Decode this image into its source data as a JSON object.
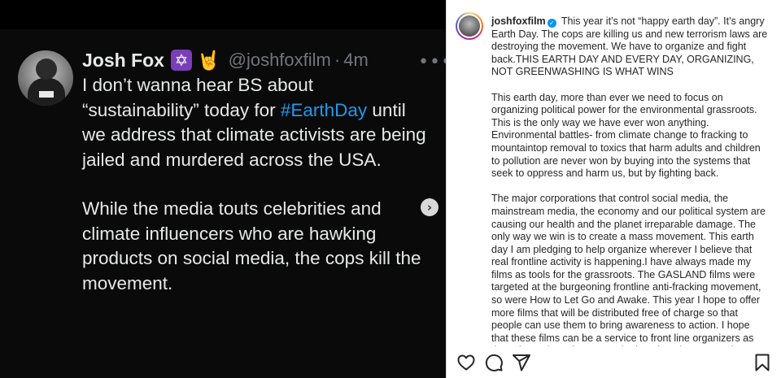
{
  "media": {
    "tweet": {
      "name": "Josh Fox",
      "emoji_1": "✡",
      "emoji_2": "🤘",
      "handle": "@joshfoxfilm",
      "separator": "·",
      "time": "4m",
      "more": "•••",
      "paragraph_1_before": "I don’t wanna hear BS about “sustainability” today for ",
      "hashtag": "#EarthDay",
      "paragraph_1_after": " until we address that climate activists are being jailed and murdered across the USA.",
      "paragraph_2": "While the media touts celebrities and climate influencers who are hawking products on social media, the cops kill the movement."
    },
    "next_button": "›"
  },
  "post": {
    "username": "joshfoxfilm",
    "verified_glyph": "✓",
    "caption_1": "This year it’s not “happy earth day”. It’s angry Earth Day. The cops are killing us and new terrorism laws are destroying the movement. We have to organize and fight back.THIS EARTH DAY AND EVERY DAY, ORGANIZING, NOT GREENWASHING IS WHAT WINS",
    "caption_2": "This earth day, more than ever we need to focus on organizing political power for the environmental grassroots. This is the only way we have ever won anything. Environmental battles- from climate change to fracking to mountaintop removal to toxics that harm adults and children to pollution are never won by buying into the systems that seek to oppress and harm us, but by fighting back.",
    "caption_3": "The major corporations that control social media, the mainstream media, the economy and our political system are causing our health and the planet irreparable damage. The only way we win is to create a mass movement. This earth day I am pledging to help organize wherever I believe that real frontline activity is happening.I have always made my films as tools for the grassroots. The GASLAND films were targeted at the burgeoning frontline anti-fracking movement, so were How to Let Go and Awake. This year I hope to offer more films that will be distributed free of charge so that people can use them to bring awareness to action. I hope that these films can be a service to front line organizers as they always have been. For the last decade or more these movies have helped to bea"
  },
  "actions": {
    "icons": [
      "heart-icon",
      "comment-icon",
      "share-icon",
      "bookmark-icon"
    ]
  },
  "colors": {
    "tweet_bg": "#000000",
    "tweet_text": "#e7e9ea",
    "tweet_muted": "#71767b",
    "hashtag": "#1d9bf0",
    "ig_text": "#262626",
    "ig_verified": "#0095f6"
  }
}
